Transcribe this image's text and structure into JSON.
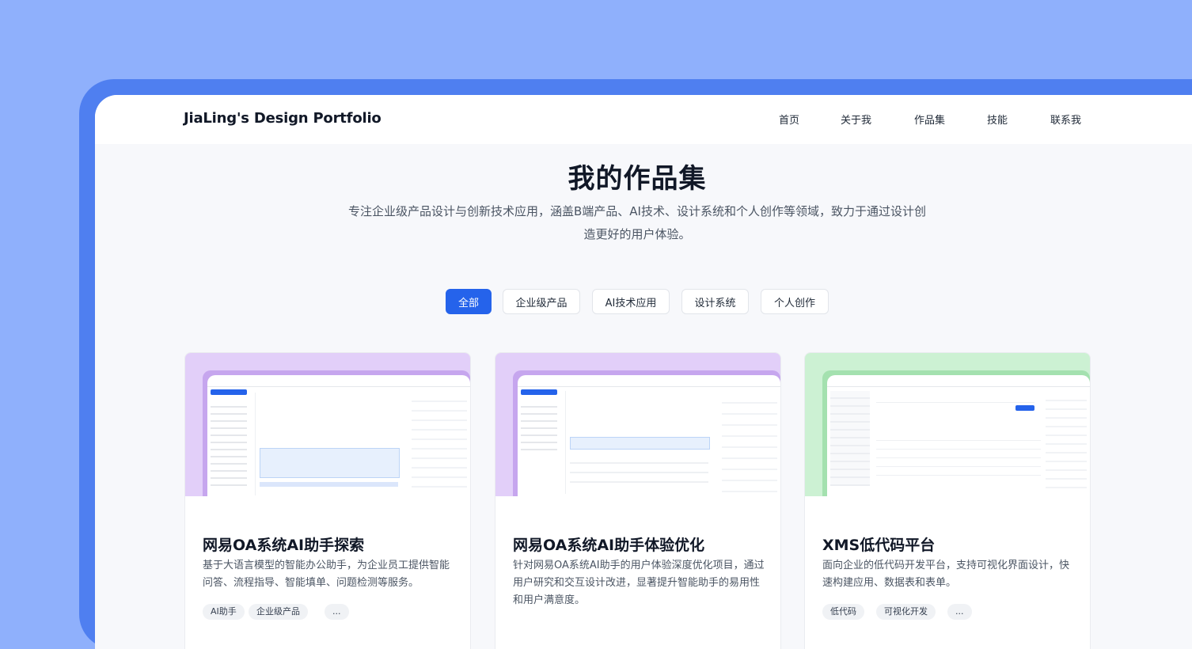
{
  "nav": {
    "brand": "JiaLing's Design Portfolio",
    "items": [
      "首页",
      "关于我",
      "作品集",
      "技能",
      "联系我"
    ]
  },
  "hero": {
    "title": "我的作品集",
    "subtitle": "专注企业级产品设计与创新技术应用，涵盖B端产品、AI技术、设计系统和个人创作等领域，致力于通过设计创造更好的用户体验。"
  },
  "filters": [
    "全部",
    "企业级产品",
    "AI技术应用",
    "设计系统",
    "个人创作"
  ],
  "active_filter": "全部",
  "colors": {
    "accent": "#2563eb",
    "frame": "#4f7ff0",
    "background": "#8fb0fc"
  },
  "cards": [
    {
      "title": "网易OA系统AI助手探索",
      "desc": "基于大语言模型的智能办公助手，为企业员工提供智能问答、流程指导、智能填单、问题检测等服务。",
      "thumb_color": "#e2cff9",
      "tags": [
        "AI助手",
        "企业级产品",
        "..."
      ]
    },
    {
      "title": "网易OA系统AI助手体验优化",
      "desc": "针对网易OA系统AI助手的用户体验深度优化项目，通过用户研究和交互设计改进，显著提升智能助手的易用性和用户满意度。",
      "thumb_color": "#e2cff9",
      "tags": []
    },
    {
      "title": "XMS低代码平台",
      "desc": "面向企业的低代码开发平台，支持可视化界面设计，快速构建应用、数据表和表单。",
      "thumb_color": "#ccf1d3",
      "tags": [
        "低代码",
        "可视化开发",
        "..."
      ]
    }
  ]
}
